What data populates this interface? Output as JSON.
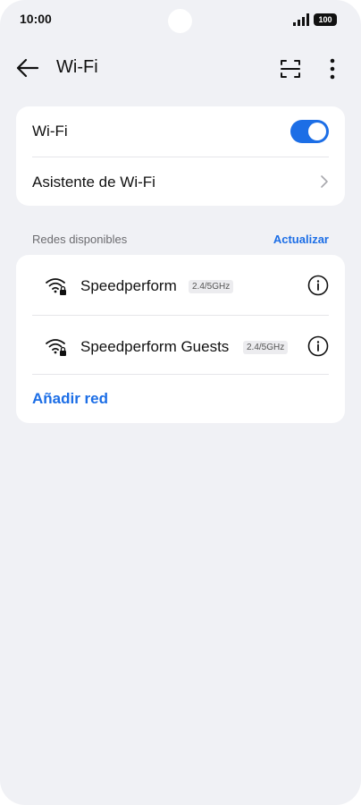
{
  "status_bar": {
    "time": "10:00",
    "battery": "100"
  },
  "header": {
    "title": "Wi-Fi",
    "icons": [
      "back-arrow-icon",
      "scan-icon",
      "more-vertical-icon"
    ]
  },
  "wifi_card": {
    "wifi_label": "Wi-Fi",
    "wifi_enabled": true,
    "assistant_label": "Asistente de Wi-Fi"
  },
  "networks_section": {
    "title": "Redes disponibles",
    "refresh_label": "Actualizar",
    "networks": [
      {
        "name": "Speedperform",
        "band": "2.4/5GHz",
        "secured": true
      },
      {
        "name": "Speedperform Guests",
        "band": "2.4/5GHz",
        "secured": true
      }
    ],
    "add_network_label": "Añadir red"
  },
  "colors": {
    "accent": "#1c6ee6",
    "background": "#f0f1f5",
    "card": "#ffffff"
  }
}
